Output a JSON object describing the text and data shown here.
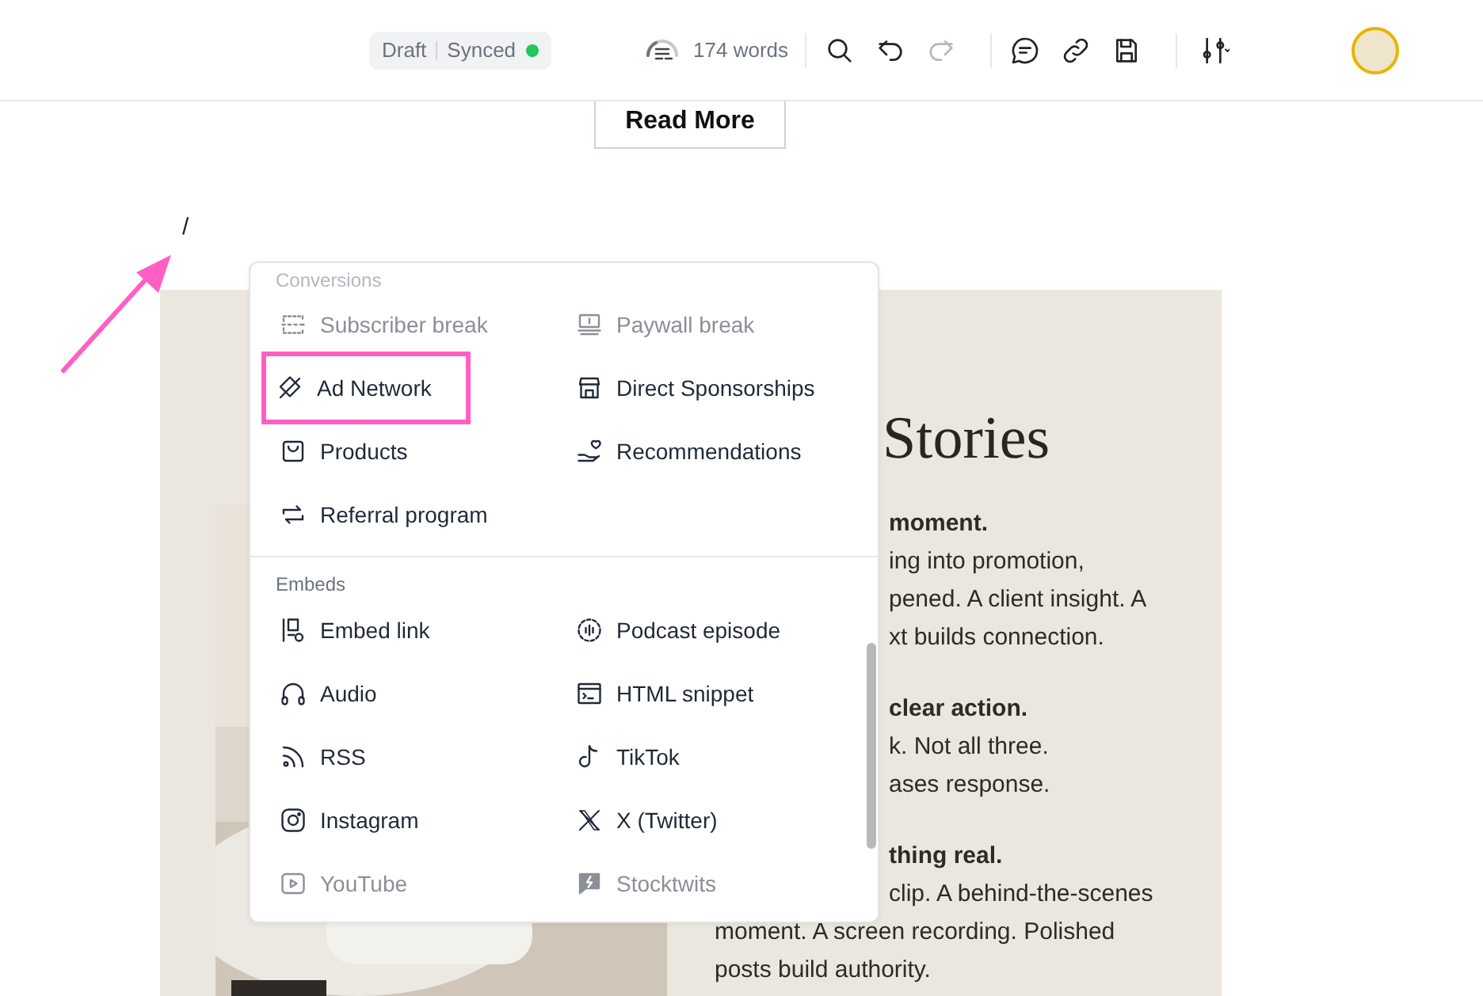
{
  "toolbar": {
    "status": {
      "draft": "Draft",
      "synced": "Synced"
    },
    "word_count": "174 words",
    "redo_disabled": true
  },
  "page": {
    "read_more": "Read More",
    "slash": "/",
    "card": {
      "heading": "Stories",
      "paragraphs": [
        [
          {
            "text": "moment.",
            "bold": true,
            "covered": true
          },
          {
            "text": "ing into promotion,",
            "bold": false,
            "covered": true
          },
          {
            "text": "pened. A client insight. A",
            "bold": false,
            "covered": true
          },
          {
            "text": "xt builds connection.",
            "bold": false,
            "covered": true
          }
        ],
        [
          {
            "text": "clear action.",
            "bold": true,
            "covered": true
          },
          {
            "text": "k. Not all three.",
            "bold": false,
            "covered": true
          },
          {
            "text": "ases response.",
            "bold": false,
            "covered": true
          }
        ],
        [
          {
            "text": "thing real.",
            "bold": true,
            "covered": true
          },
          {
            "text": "clip. A behind-the-scenes",
            "bold": false,
            "covered": true
          },
          {
            "text": "moment. A screen recording. Polished",
            "bold": false
          },
          {
            "text": "posts build authority.",
            "bold": false
          }
        ]
      ]
    }
  },
  "menu": {
    "sections": [
      {
        "title": "Conversions",
        "faded": true,
        "items": [
          {
            "label": "Subscriber break",
            "disabled": true,
            "highlighted": false
          },
          {
            "label": "Paywall break",
            "disabled": true,
            "highlighted": false
          },
          {
            "label": "Ad Network",
            "disabled": false,
            "highlighted": true
          },
          {
            "label": "Direct Sponsorships",
            "disabled": false,
            "highlighted": false
          },
          {
            "label": "Products",
            "disabled": false,
            "highlighted": false
          },
          {
            "label": "Recommendations",
            "disabled": false,
            "highlighted": false
          },
          {
            "label": "Referral program",
            "disabled": false,
            "highlighted": false
          }
        ]
      },
      {
        "title": "Embeds",
        "faded": false,
        "items": [
          {
            "label": "Embed link",
            "disabled": false,
            "highlighted": false
          },
          {
            "label": "Podcast episode",
            "disabled": false,
            "highlighted": false
          },
          {
            "label": "Audio",
            "disabled": false,
            "highlighted": false
          },
          {
            "label": "HTML snippet",
            "disabled": false,
            "highlighted": false
          },
          {
            "label": "RSS",
            "disabled": false,
            "highlighted": false
          },
          {
            "label": "TikTok",
            "disabled": false,
            "highlighted": false
          },
          {
            "label": "Instagram",
            "disabled": false,
            "highlighted": false
          },
          {
            "label": "X (Twitter)",
            "disabled": false,
            "highlighted": false
          },
          {
            "label": "YouTube",
            "disabled": true,
            "highlighted": false
          },
          {
            "label": "Stocktwits",
            "disabled": true,
            "highlighted": false
          }
        ]
      }
    ]
  }
}
